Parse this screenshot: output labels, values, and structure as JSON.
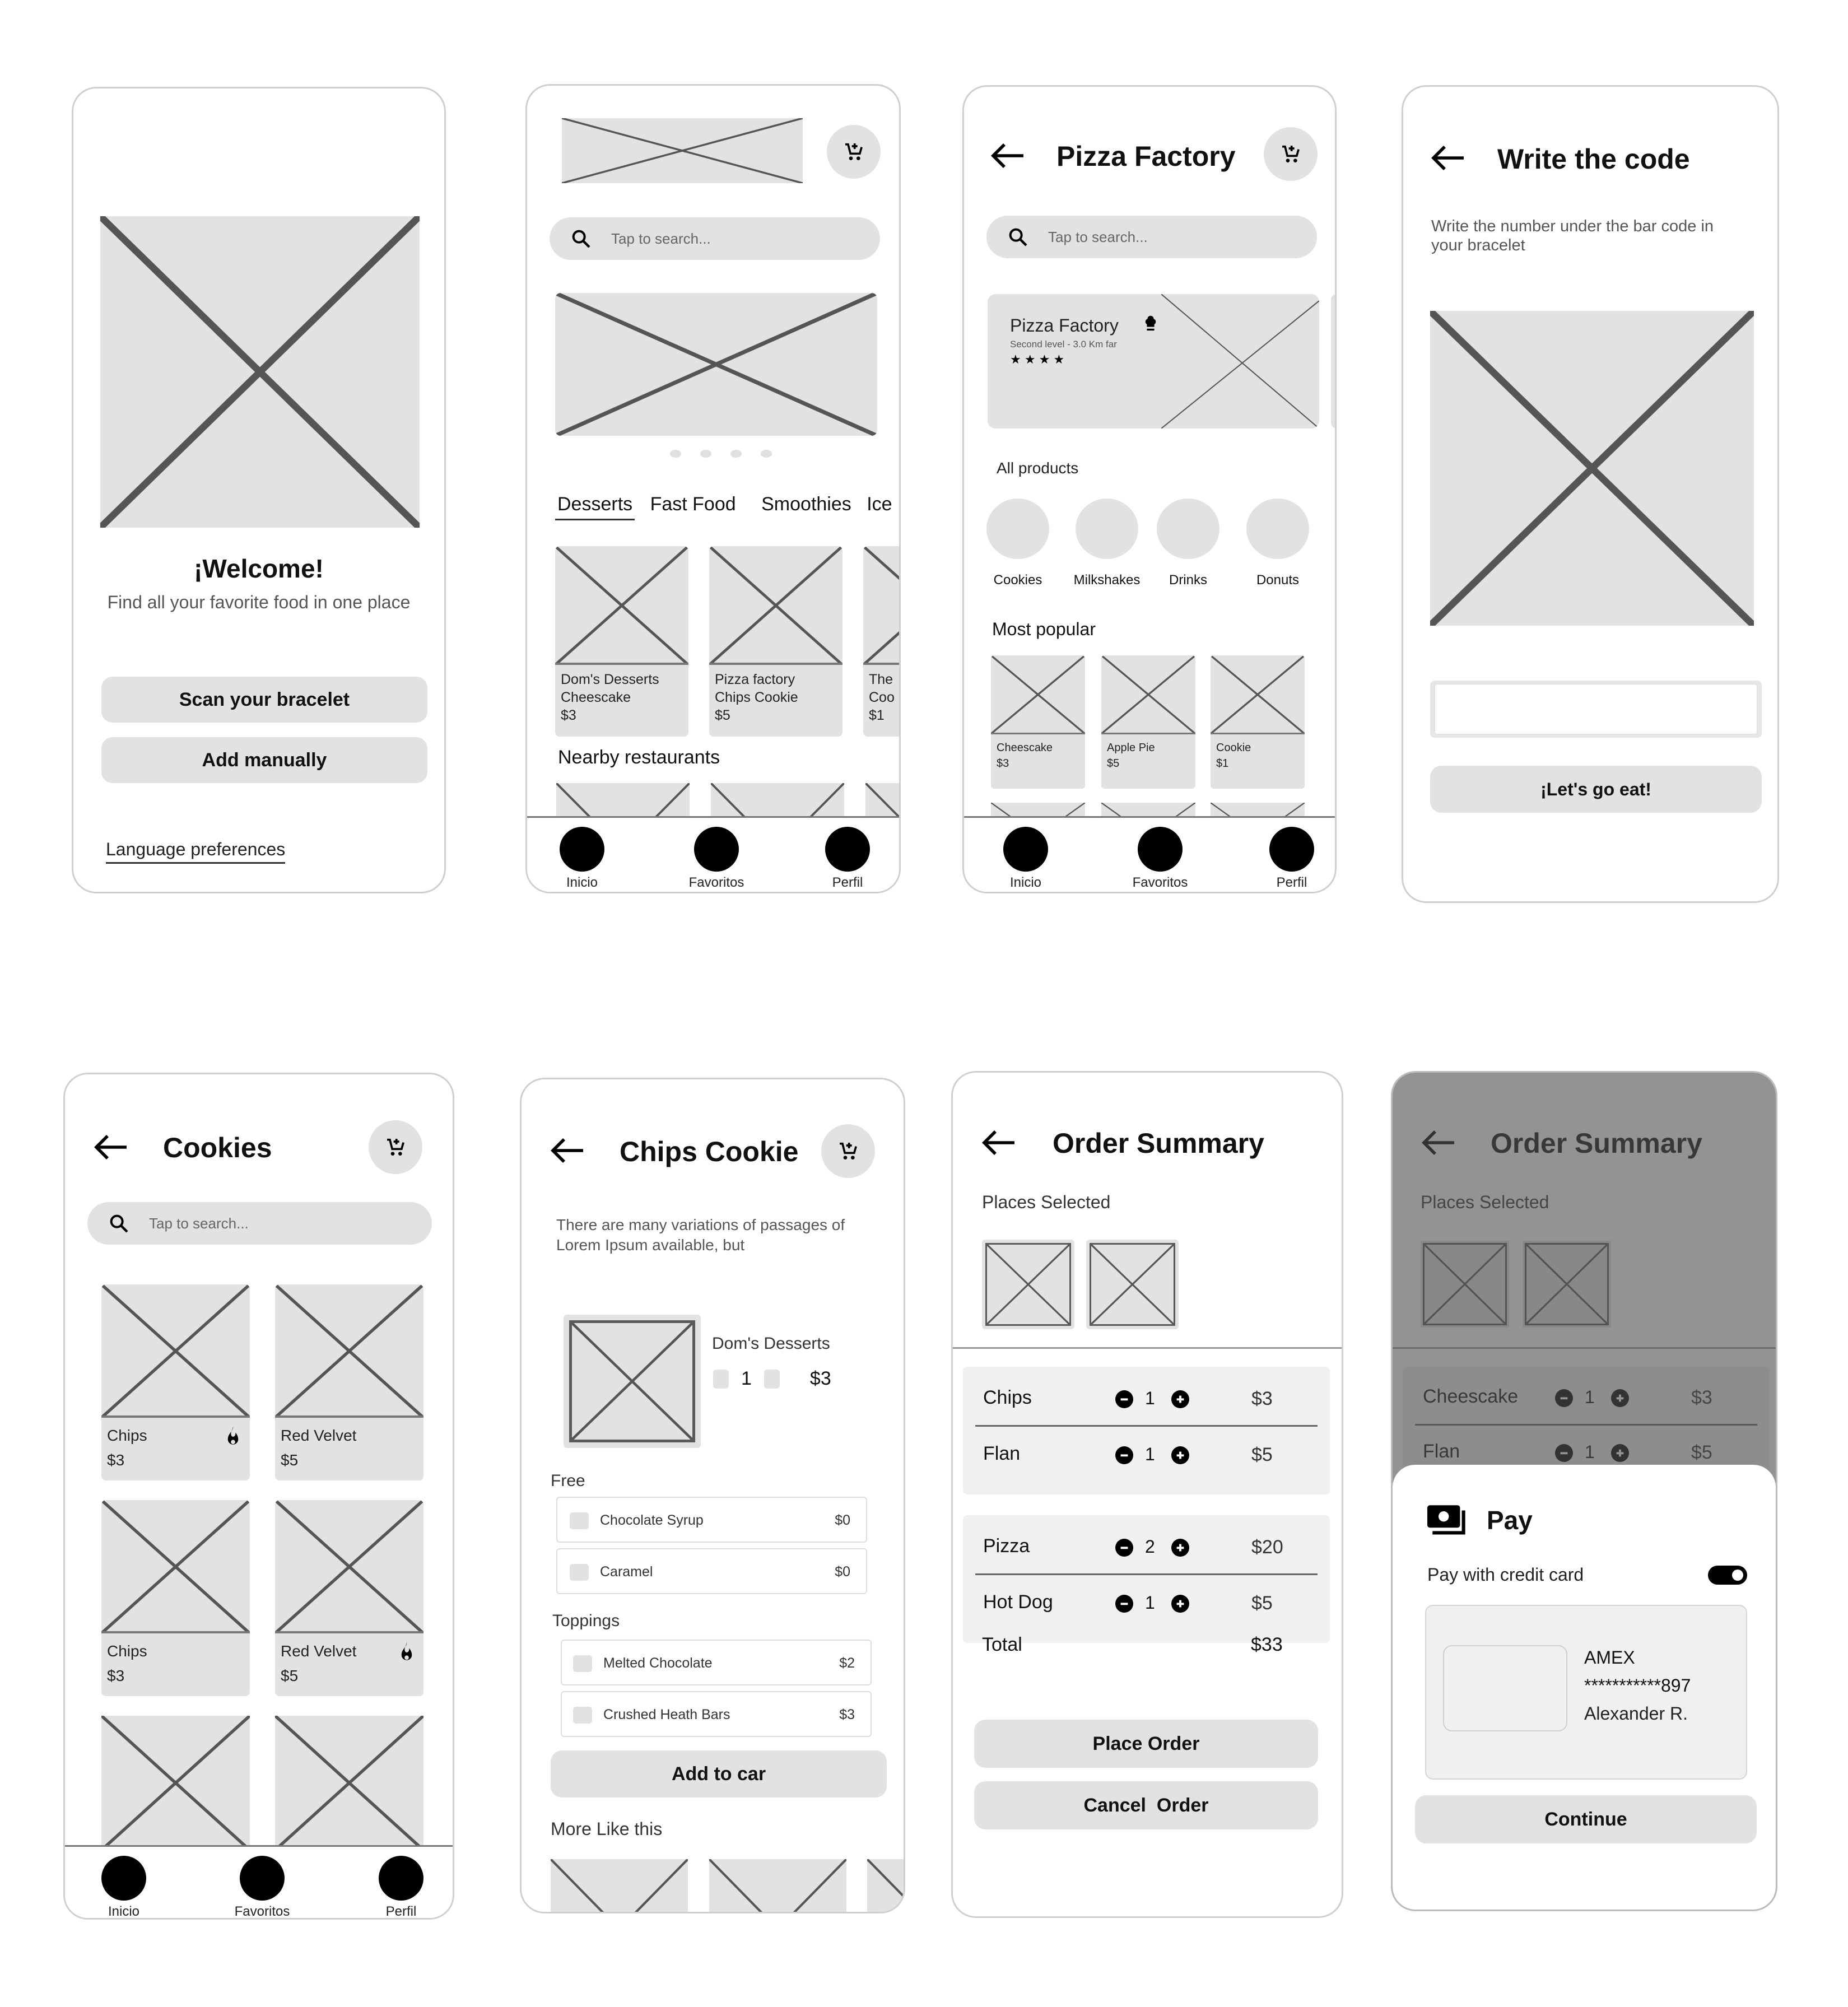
{
  "welcome": {
    "heading": "¡Welcome!",
    "subtitle": "Find all your favorite food in one place",
    "scan_button": "Scan your bracelet",
    "manual_button": "Add manually",
    "language_link": "Language preferences"
  },
  "home": {
    "search_placeholder": "Tap to search...",
    "carousel_dots": 4,
    "categories": [
      "Desserts",
      "Fast Food",
      "Smoothies",
      "Ice"
    ],
    "active_category": "Desserts",
    "featured": [
      {
        "restaurant": "Dom's Desserts",
        "product": "Cheescake",
        "price": "$3"
      },
      {
        "restaurant": "Pizza factory",
        "product": "Chips Cookie",
        "price": "$5"
      },
      {
        "restaurant": "The",
        "product": "Coo",
        "price": "$1"
      }
    ],
    "nearby_title": "Nearby restaurants"
  },
  "nav": {
    "items": [
      "Inicio",
      "Favoritos",
      "Perfil"
    ]
  },
  "restaurant": {
    "title": "Pizza Factory",
    "search_placeholder": "Tap to search...",
    "banner": {
      "name": "Pizza Factory",
      "detail": "Second level - 3.0 Km far",
      "rating": 4,
      "stars": "★ ★ ★ ★"
    },
    "all_products_title": "All products",
    "product_categories": [
      "Cookies",
      "Milkshakes",
      "Drinks",
      "Donuts"
    ],
    "popular_title": "Most popular",
    "popular": [
      {
        "name": "Cheescake",
        "price": "$3"
      },
      {
        "name": "Apple Pie",
        "price": "$5"
      },
      {
        "name": "Cookie",
        "price": "$1"
      }
    ]
  },
  "code": {
    "title": "Write the code",
    "instructions": "Write the number under the bar code in your bracelet",
    "input_value": "",
    "submit_button": "¡Let's go eat!"
  },
  "cookies": {
    "title": "Cookies",
    "search_placeholder": "Tap to search...",
    "items": [
      {
        "name": "Chips",
        "price": "$3",
        "hot": true
      },
      {
        "name": "Red Velvet",
        "price": "$5",
        "hot": false
      },
      {
        "name": "Chips",
        "price": "$3",
        "hot": false
      },
      {
        "name": "Red Velvet",
        "price": "$5",
        "hot": true
      }
    ]
  },
  "product": {
    "title": "Chips Cookie",
    "description": "There are many variations of passages of Lorem Ipsum available, but",
    "restaurant": "Dom's Desserts",
    "quantity": "1",
    "price": "$3",
    "free_title": "Free",
    "free_options": [
      {
        "name": "Chocolate Syrup",
        "price": "$0"
      },
      {
        "name": "Caramel",
        "price": "$0"
      }
    ],
    "toppings_title": "Toppings",
    "toppings": [
      {
        "name": "Melted Chocolate",
        "price": "$2"
      },
      {
        "name": "Crushed Heath Bars",
        "price": "$3"
      }
    ],
    "add_button": "Add to car",
    "more_title": "More Like this"
  },
  "order": {
    "title": "Order Summary",
    "places_title": "Places Selected",
    "groups": [
      [
        {
          "name": "Chips",
          "qty": "1",
          "price": "$3"
        },
        {
          "name": "Flan",
          "qty": "1",
          "price": "$5"
        }
      ],
      [
        {
          "name": "Pizza",
          "qty": "2",
          "price": "$20"
        },
        {
          "name": "Hot Dog",
          "qty": "1",
          "price": "$5"
        }
      ]
    ],
    "total_label": "Total",
    "total_value": "$33",
    "place_button": "Place Order",
    "cancel_button": "Cancel  Order"
  },
  "pay": {
    "bg_title": "Order Summary",
    "bg_places_title": "Places Selected",
    "bg_items": [
      {
        "name": "Cheescake",
        "qty": "1",
        "price": "$3"
      },
      {
        "name": "Flan",
        "qty": "1",
        "price": "$5"
      }
    ],
    "sheet_title": "Pay",
    "credit_label": "Pay with credit card",
    "credit_enabled": true,
    "card_brand": "AMEX",
    "card_number": "***********897",
    "card_holder": "Alexander R.",
    "continue_button": "Continue"
  }
}
